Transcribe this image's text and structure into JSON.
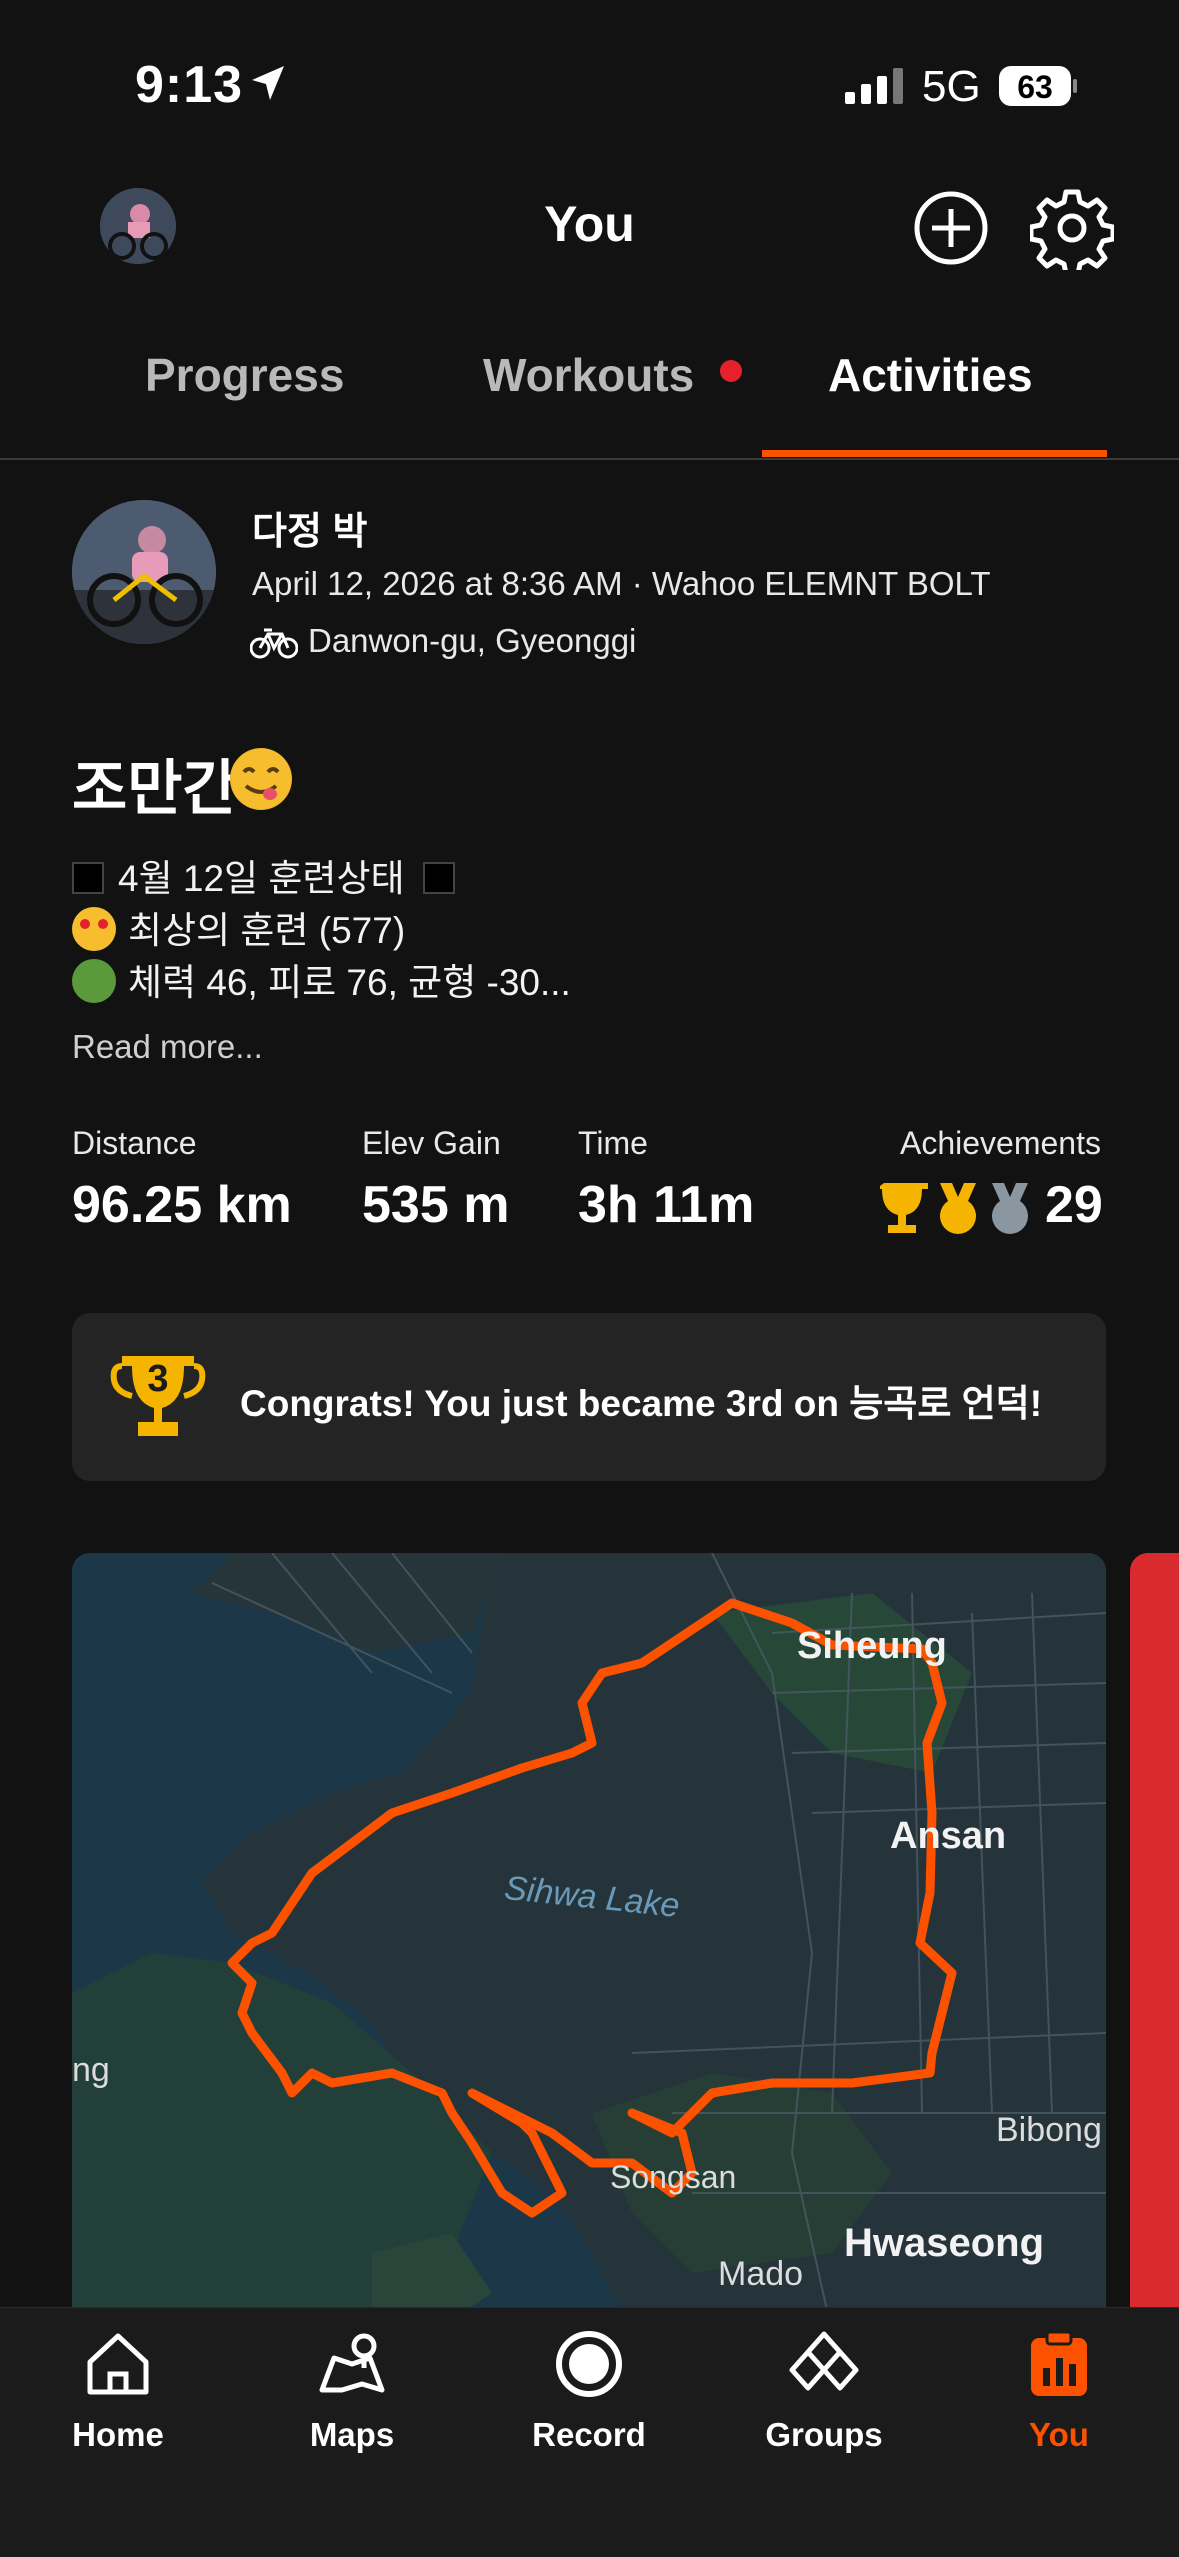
{
  "status_bar": {
    "time": "9:13",
    "network": "5G",
    "battery": "63"
  },
  "header": {
    "title": "You"
  },
  "tabs": [
    {
      "label": "Progress"
    },
    {
      "label": "Workouts"
    },
    {
      "label": "Activities"
    }
  ],
  "activity": {
    "athlete": "다정 박",
    "meta": "April 12, 2026 at 8:36 AM · Wahoo ELEMNT BOLT",
    "location": "Danwon-gu, Gyeonggi",
    "title": "조만간",
    "description": [
      "4월 12일 훈련상태",
      "최상의 훈련 (577)",
      "체력 46, 피로 76, 균형 -30..."
    ],
    "read_more": "Read more...",
    "stats": {
      "distance_label": "Distance",
      "distance": "96.25 km",
      "elev_label": "Elev Gain",
      "elev": "535 m",
      "time_label": "Time",
      "time": "3h 11m",
      "achievements_label": "Achievements",
      "achievements": "29"
    },
    "congrats": "Congrats! You just became 3rd on 능곡로 언덕!",
    "congrats_rank": "3"
  },
  "map": {
    "labels": [
      "Siheung",
      "Ansan",
      "Sihwa Lake",
      "Bibong",
      "Songsan",
      "Hwaseong",
      "Mado",
      "ng"
    ]
  },
  "bottom_nav": [
    {
      "label": "Home"
    },
    {
      "label": "Maps"
    },
    {
      "label": "Record"
    },
    {
      "label": "Groups"
    },
    {
      "label": "You"
    }
  ],
  "colors": {
    "accent": "#fc5200",
    "background": "#121212",
    "card": "#242424",
    "gold": "#f4b400",
    "notification": "#e5212e"
  }
}
